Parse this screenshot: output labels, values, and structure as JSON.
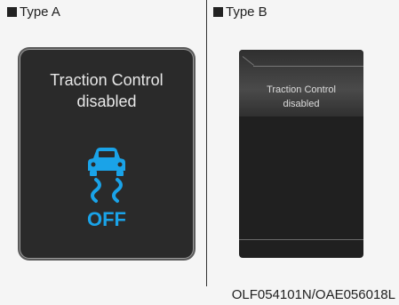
{
  "type_a": {
    "label": "Type A",
    "message_line1": "Traction Control",
    "message_line2": "disabled",
    "icon": "traction-control-off-icon",
    "icon_text": "OFF",
    "icon_color": "#1aa3e8"
  },
  "type_b": {
    "label": "Type B",
    "message_line1": "Traction Control",
    "message_line2": "disabled"
  },
  "caption": "OLF054101N/OAE056018L"
}
